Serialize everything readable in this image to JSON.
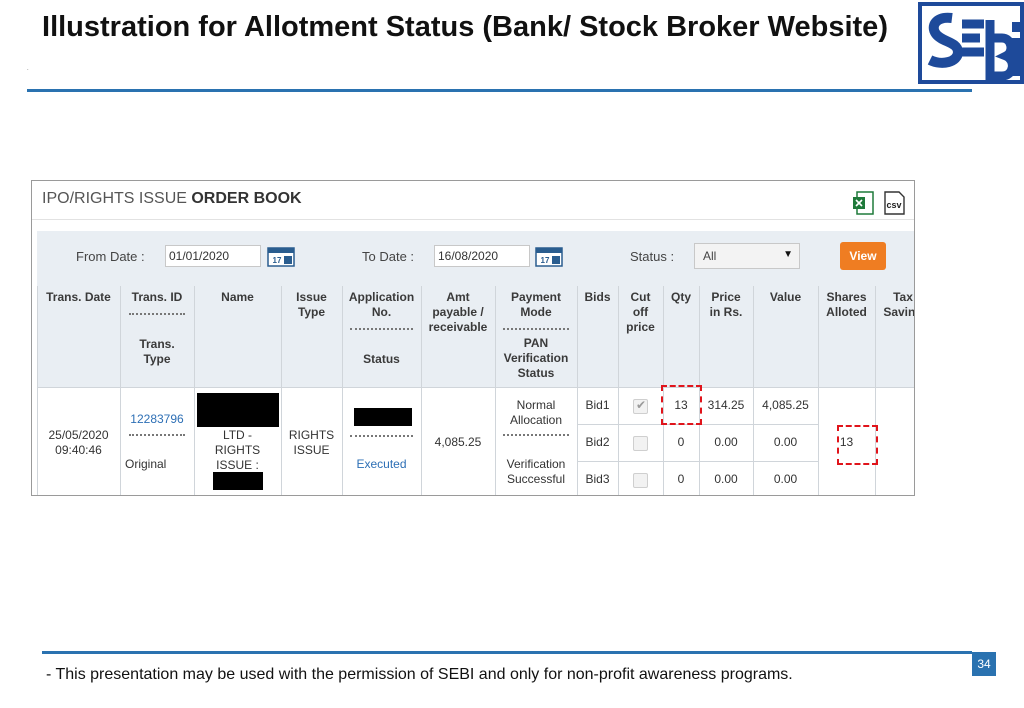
{
  "slide": {
    "title": "Illustration for Allotment Status (Bank/ Stock Broker Website)",
    "dot": ".",
    "footer": "- This presentation may be used with the permission of SEBI and only for non-profit awareness programs.",
    "page_number": "34",
    "logo_text": "SEBI",
    "colors": {
      "accent": "#2a72b0",
      "highlight": "#e0141b",
      "button": "#ef7d22"
    }
  },
  "screen": {
    "title_light": "IPO/RIGHTS ISSUE ",
    "title_bold": "ORDER BOOK",
    "icons": [
      "excel-icon",
      "csv-icon",
      "calendar-icon"
    ],
    "csv_label": "csv",
    "filters": {
      "from_label": "From Date :",
      "from_value": "01/01/2020",
      "to_label": "To Date :",
      "to_value": "16/08/2020",
      "status_label": "Status :",
      "status_value": "All",
      "view_button": "View",
      "calendar_day": "17"
    },
    "headers": {
      "trans_date": "Trans. Date",
      "trans_id": "Trans. ID",
      "trans_type": "Trans.\nType",
      "name": "Name",
      "issue_type": "Issue\nType",
      "application_no": "Application\nNo.",
      "status": "Status",
      "amt_payable": "Amt\npayable /\nreceivable",
      "payment_mode": "Payment\nMode",
      "pan_status": "PAN\nVerification\nStatus",
      "bids": "Bids",
      "cut_off_price": "Cut\noff\nprice",
      "qty": "Qty",
      "price": "Price\nin Rs.",
      "value": "Value",
      "shares_alloted": "Shares\nAlloted",
      "tax_saving": "Tax\nSaving"
    },
    "row": {
      "trans_date": "25/05/2020\n09:40:46",
      "trans_id": "12283796",
      "trans_type": "Original",
      "name": "LTD -\nRIGHTS\nISSUE :",
      "issue_type": "RIGHTS\nISSUE",
      "status": "Executed",
      "amount": "4,085.25",
      "payment_mode": "Normal\nAllocation",
      "pan_status": "Verification\nSuccessful",
      "shares_alloted": "13",
      "bids": [
        {
          "bid": "Bid1",
          "cutoff_checked": true,
          "qty": "13",
          "price": "314.25",
          "value": "4,085.25"
        },
        {
          "bid": "Bid2",
          "cutoff_checked": false,
          "qty": "0",
          "price": "0.00",
          "value": "0.00"
        },
        {
          "bid": "Bid3",
          "cutoff_checked": false,
          "qty": "0",
          "price": "0.00",
          "value": "0.00"
        }
      ]
    }
  }
}
